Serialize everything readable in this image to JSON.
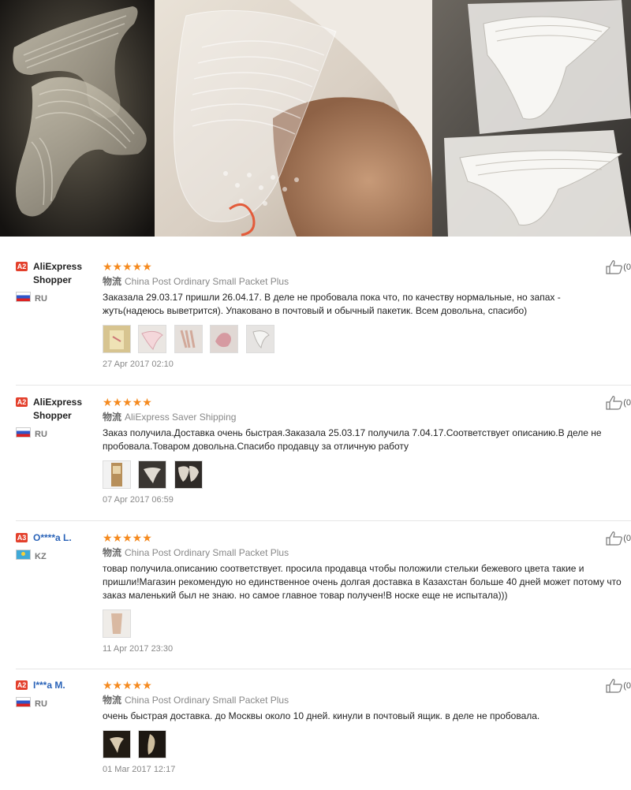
{
  "photos": [
    {
      "name": "gel-insoles-dark",
      "icon": "product-photo"
    },
    {
      "name": "gel-insole-in-shoe",
      "icon": "product-photo"
    },
    {
      "name": "gel-insoles-packaged",
      "icon": "product-photo"
    }
  ],
  "colors": {
    "star": "#f58a1f",
    "level_a2": "#e3402c",
    "level_a3": "#e3402c",
    "anon_name": "#2a63b8"
  },
  "reviews": [
    {
      "level": "A2",
      "buyer": "AliExpress Shopper",
      "country": "RU",
      "stars": "★★★★★",
      "shipping_cn": "物流",
      "shipping": "China Post Ordinary Small Packet Plus",
      "text": "Заказала 29.03.17 пришли 26.04.17. В деле не пробовала пока что, по качеству нормальные, но запах - жуть(надеюсь выветрится). Упаковано в почтовый и обычный пакетик. Всем довольна, спасибо)",
      "date": "27 Apr 2017 02:10",
      "helpful": "(0",
      "thumb_count": 5
    },
    {
      "level": "A2",
      "buyer": "AliExpress Shopper",
      "country": "RU",
      "stars": "★★★★★",
      "shipping_cn": "物流",
      "shipping": "AliExpress Saver Shipping",
      "text": "Заказ получила.Доставка очень быстрая.Заказала 25.03.17 получила 7.04.17.Соответствует описанию.В деле не пробовала.Товаром довольна.Спасибо продавцу за отличную работу",
      "date": "07 Apr 2017 06:59",
      "helpful": "(0",
      "thumb_count": 3
    },
    {
      "level": "A3",
      "buyer": "O****a L.",
      "country": "KZ",
      "stars": "★★★★★",
      "shipping_cn": "物流",
      "shipping": "China Post Ordinary Small Packet Plus",
      "text": "товар получила.описанию соответствует. просила продавца чтобы положили стельки бежевого цвета такие и пришли!Магазин рекомендую но единственное очень долгая доставка в Казахстан больше 40 дней может потому что заказ маленький был не знаю. но самое главное товар получен!В носке еще не испытала)))",
      "date": "11 Apr 2017 23:30",
      "helpful": "(0",
      "thumb_count": 1
    },
    {
      "level": "A2",
      "buyer": "I***a M.",
      "country": "RU",
      "stars": "★★★★★",
      "shipping_cn": "物流",
      "shipping": "China Post Ordinary Small Packet Plus",
      "text": "очень быстрая доставка. до Москвы около 10 дней. кинули в почтовый ящик. в деле не пробовала.",
      "date": "01 Mar 2017 12:17",
      "helpful": "(0",
      "thumb_count": 2
    }
  ]
}
